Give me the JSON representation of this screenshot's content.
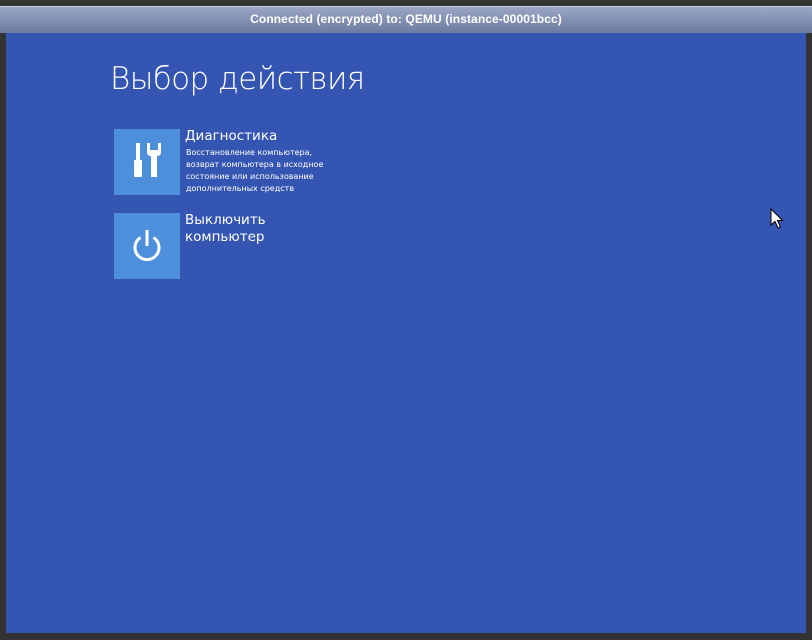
{
  "window": {
    "title": "Connected (encrypted) to: QEMU (instance-00001bcc)"
  },
  "screen": {
    "heading": "Выбор действия",
    "background_color": "#3555b3",
    "tile_color": "#4d8fdb"
  },
  "options": [
    {
      "id": "troubleshoot",
      "title": "Диагностика",
      "icon": "tools-icon",
      "description_lines": [
        "Восстановление компьютера,",
        "возврат компьютера в исходное",
        "состояние или использование",
        "дополнительных средств"
      ]
    },
    {
      "id": "shutdown",
      "title_lines": [
        "Выключить",
        "компьютер"
      ],
      "icon": "power-icon"
    }
  ]
}
